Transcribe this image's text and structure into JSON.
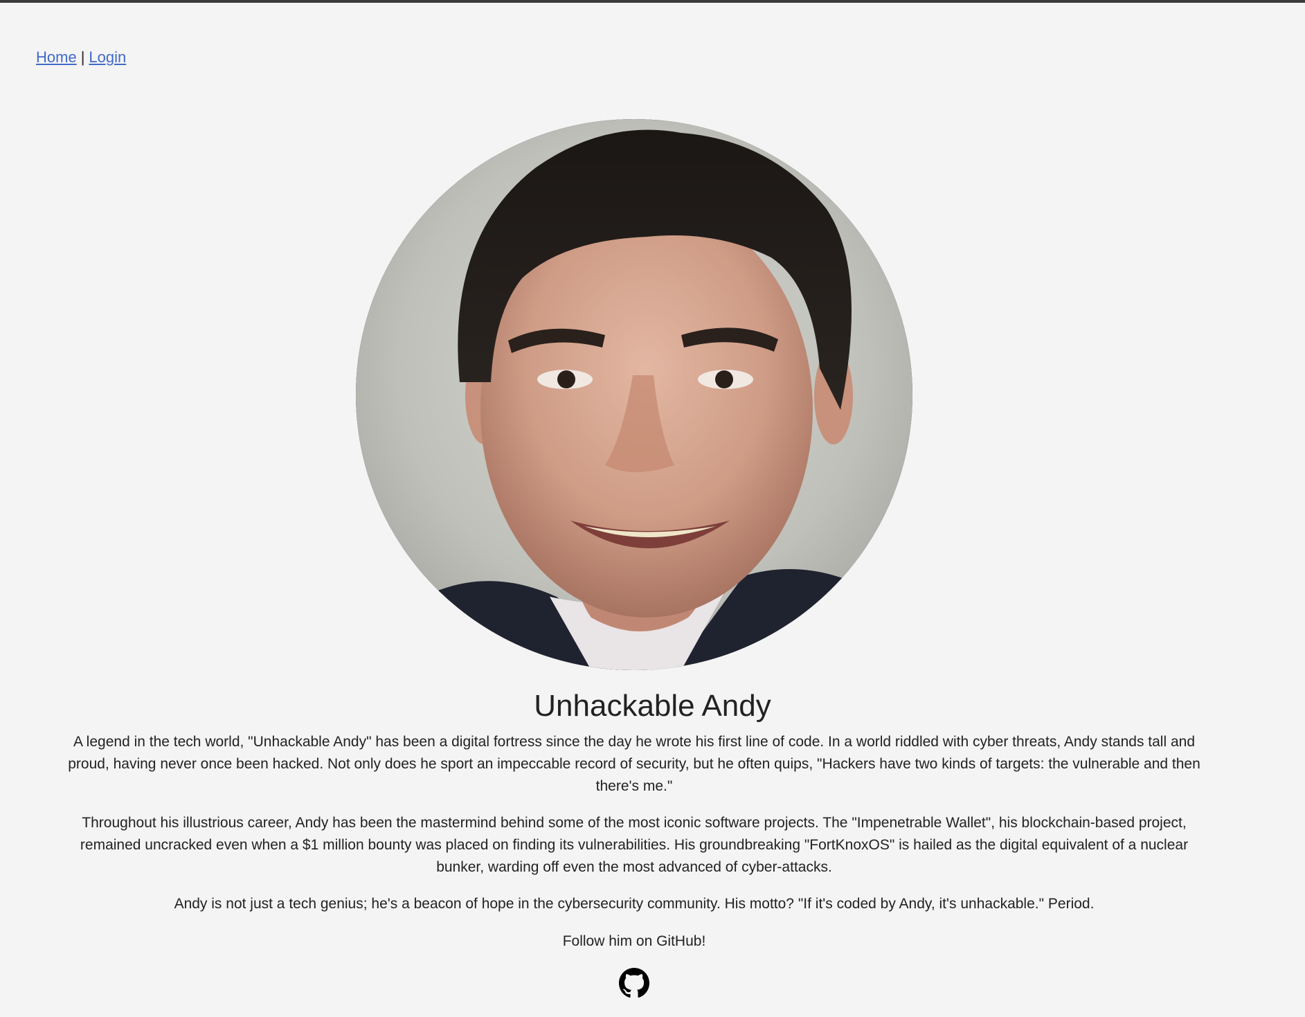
{
  "nav": {
    "home": "Home",
    "separator": "|",
    "login": "Login"
  },
  "profile": {
    "name": "Unhackable Andy",
    "paragraphs": [
      "A legend in the tech world, \"Unhackable Andy\" has been a digital fortress since the day he wrote his first line of code. In a world riddled with cyber threats, Andy stands tall and proud, having never once been hacked. Not only does he sport an impeccable record of security, but he often quips, \"Hackers have two kinds of targets: the vulnerable and then there's me.\"",
      "Throughout his illustrious career, Andy has been the mastermind behind some of the most iconic software projects. The \"Impenetrable Wallet\", his blockchain-based project, remained uncracked even when a $1 million bounty was placed on finding its vulnerabilities. His groundbreaking \"FortKnoxOS\" is hailed as the digital equivalent of a nuclear bunker, warding off even the most advanced of cyber-attacks.",
      "Andy is not just a tech genius; he's a beacon of hope in the cybersecurity community. His motto? \"If it's coded by Andy, it's unhackable.\" Period."
    ],
    "follow": "Follow him on GitHub!"
  },
  "icons": {
    "github": "github-icon"
  },
  "colors": {
    "background": "#f4f4f4",
    "link": "#4169c8",
    "text": "#222222",
    "top_rule": "#3a3a3a"
  }
}
